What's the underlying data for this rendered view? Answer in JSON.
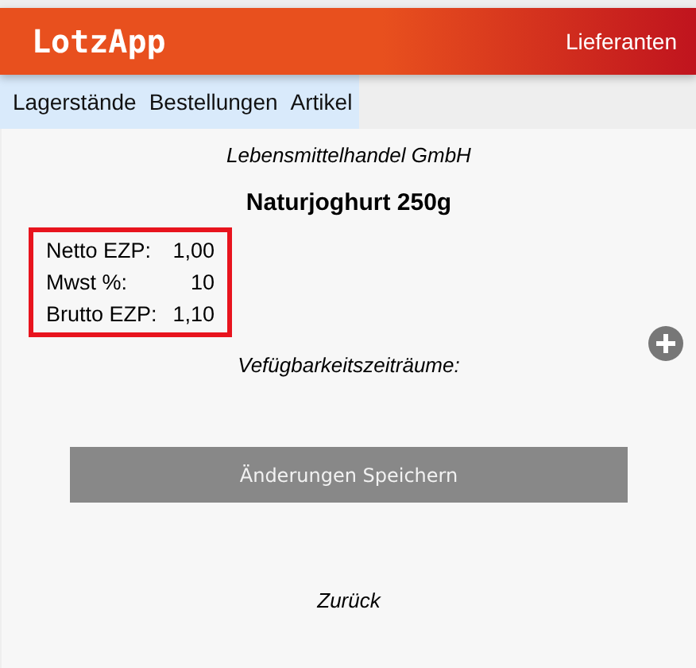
{
  "header": {
    "logo": "LotzApp",
    "link": "Lieferanten"
  },
  "nav": [
    "Lagerstände",
    "Bestellungen",
    "Artikel"
  ],
  "supplier": "Lebensmittelhandel GmbH",
  "product": "Naturjoghurt 250g",
  "prices": [
    {
      "label": "Netto EZP:",
      "value": "1,00"
    },
    {
      "label": "Mwst %:",
      "value": "10"
    },
    {
      "label": "Brutto EZP:",
      "value": "1,10"
    }
  ],
  "availability_heading": "Vefügbarkeitszeiträume:",
  "save_button": "Änderungen Speichern",
  "back_link": "Zurück"
}
